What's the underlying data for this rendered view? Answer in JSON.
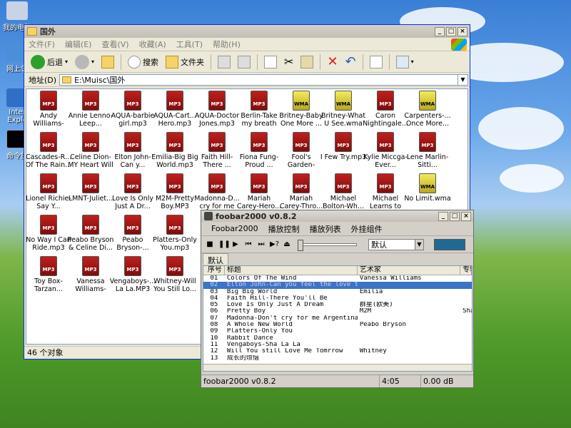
{
  "desktop": {
    "icons": [
      {
        "label": "我的电脑"
      },
      {
        "label": "网上邻"
      },
      {
        "label": "Inter Explo"
      },
      {
        "label": "命令提"
      }
    ]
  },
  "explorer": {
    "title": "国外",
    "menu": [
      "文件(F)",
      "编辑(E)",
      "查看(V)",
      "收藏(A)",
      "工具(T)",
      "帮助(H)"
    ],
    "toolbar": {
      "back": "后退",
      "search": "搜索",
      "folders": "文件夹"
    },
    "address_label": "地址(D)",
    "address_value": "E:\\Muisc\\国外",
    "files": [
      {
        "name": "Andy Williams-Unc...",
        "type": "MP3"
      },
      {
        "name": "Annie Lenno-Leep...",
        "type": "MP3"
      },
      {
        "name": "AQUA-barbie girl.mp3",
        "type": "MP3"
      },
      {
        "name": "AQUA-Cart... Hero.mp3",
        "type": "MP3"
      },
      {
        "name": "AQUA-Doctor Jones.mp3",
        "type": "MP3"
      },
      {
        "name": "Berlin-Take my breath awa...",
        "type": "MP3"
      },
      {
        "name": "Britney-Baby One More ...",
        "type": "WMA"
      },
      {
        "name": "Britney-What U See.wma",
        "type": "WMA"
      },
      {
        "name": "Caron Nightingale...",
        "type": "MP3"
      },
      {
        "name": "Carpenters-... Once More...",
        "type": "WMA"
      },
      {
        "name": "Cascades-R... Of The Rain...",
        "type": "MP3"
      },
      {
        "name": "Celine Dion-MY Heart Will B...",
        "type": "MP3"
      },
      {
        "name": "Elton John-Can y...",
        "type": "MP3"
      },
      {
        "name": "Emilia-Big Big World.mp3",
        "type": "MP3"
      },
      {
        "name": "Faith Hill-There ...",
        "type": "MP3"
      },
      {
        "name": "Fiona Fung-Proud ...",
        "type": "MP3"
      },
      {
        "name": "Fool's Garden-Lem...",
        "type": "MP3"
      },
      {
        "name": "I Few Try.mp3",
        "type": "MP3"
      },
      {
        "name": "Kylie Miccga-Ever...",
        "type": "MP3"
      },
      {
        "name": "Lene Marlin-Sitti...",
        "type": "MP3"
      },
      {
        "name": "Lionel Richie-Say Y...",
        "type": "MP3"
      },
      {
        "name": "LMNT-Juliet...",
        "type": "MP3"
      },
      {
        "name": "Love Is Only Just A Dr...",
        "type": "MP3"
      },
      {
        "name": "M2M-Pretty Boy.MP3",
        "type": "MP3"
      },
      {
        "name": "Madonna-D... cry for me A...",
        "type": "MP3"
      },
      {
        "name": "Mariah Carey-Hero...",
        "type": "MP3"
      },
      {
        "name": "Mariah Carey-Thro...",
        "type": "MP3"
      },
      {
        "name": "Michael Bolton-Wh...",
        "type": "MP3"
      },
      {
        "name": "Michael Learns to Rock-Tak...",
        "type": "MP3"
      },
      {
        "name": "No Limit.wma",
        "type": "WMA"
      },
      {
        "name": "No Way I Can Ride.mp3",
        "type": "MP3"
      },
      {
        "name": "Peabo Bryson & Celine Di...",
        "type": "MP3"
      },
      {
        "name": "Peabo Bryson-...",
        "type": "MP3"
      },
      {
        "name": "Platters-Only You.mp3",
        "type": "MP3"
      },
      {
        "name": "",
        "type": ""
      },
      {
        "name": "",
        "type": ""
      },
      {
        "name": "",
        "type": ""
      },
      {
        "name": "",
        "type": ""
      },
      {
        "name": "",
        "type": ""
      },
      {
        "name": "",
        "type": ""
      },
      {
        "name": "Toy Box-Tarzan...",
        "type": "MP3"
      },
      {
        "name": "Vanessa Williams-Col...",
        "type": "MP3"
      },
      {
        "name": "Vengaboys-... La La.MP3",
        "type": "MP3"
      },
      {
        "name": "Whitney-Will You Still Lo...",
        "type": "MP3"
      }
    ],
    "status": "46 个对象"
  },
  "foobar": {
    "title": "foobar2000 v0.8.2",
    "menu": [
      "Foobar2000",
      "播放控制",
      "播放列表",
      "外挂组件"
    ],
    "preset": "默认",
    "tab": "默认",
    "columns": [
      "序号",
      "标题",
      "艺术家",
      "专辑"
    ],
    "rows": [
      {
        "n": "01",
        "title": "Colors Of The Wind",
        "artist": "Vanessa Williams",
        "album": ""
      },
      {
        "n": "02",
        "title": "Elton John-Can you feel the love to...",
        "artist": "",
        "album": ""
      },
      {
        "n": "03",
        "title": "Big Big World",
        "artist": "Emilia",
        "album": ""
      },
      {
        "n": "04",
        "title": "Faith Hill-There You'll Be",
        "artist": "",
        "album": ""
      },
      {
        "n": "05",
        "title": "Love Is Only Just A Dream",
        "artist": "群星(欧美)",
        "album": ""
      },
      {
        "n": "06",
        "title": "Pretty Boy",
        "artist": "M2M",
        "album": "Sha"
      },
      {
        "n": "07",
        "title": "Madonna-Don't cry for me Argentina",
        "artist": "",
        "album": ""
      },
      {
        "n": "08",
        "title": "A Whole New World",
        "artist": "Peabo Bryson",
        "album": ""
      },
      {
        "n": "09",
        "title": "Platters-Only You",
        "artist": "",
        "album": ""
      },
      {
        "n": "10",
        "title": "Rabbit Dance",
        "artist": "",
        "album": ""
      },
      {
        "n": "11",
        "title": "Vengaboys-Sha La La",
        "artist": "",
        "album": ""
      },
      {
        "n": "12",
        "title": "Will You still Love Me Tomrrow",
        "artist": "Whitney",
        "album": ""
      },
      {
        "n": "13",
        "title": "成长的烦恼",
        "artist": "",
        "album": ""
      }
    ],
    "selected_row": 1,
    "status_app": "foobar2000 v0.8.2",
    "status_time": "4:05",
    "status_db": "0.00 dB",
    "accent": "#3b73c6"
  }
}
